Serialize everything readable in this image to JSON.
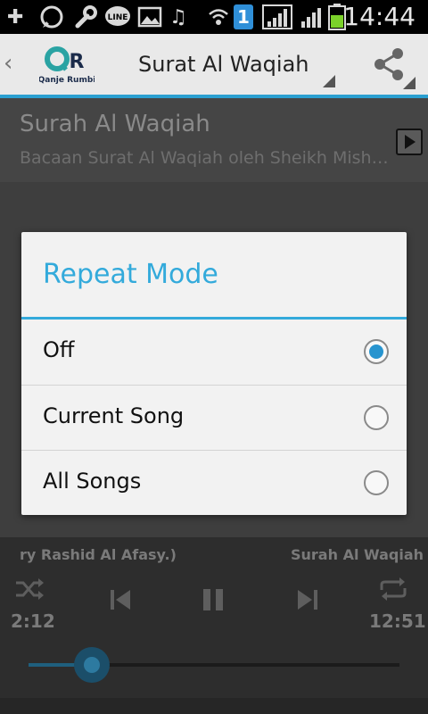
{
  "status_bar": {
    "time": "14:44",
    "notification_badge": "1",
    "icons": [
      "add-icon",
      "whatsapp-icon",
      "wrench-icon",
      "line-icon",
      "image-icon",
      "music-note-icon",
      "wifi-icon",
      "notification-badge-icon",
      "signal-icon",
      "signal-icon",
      "battery-icon"
    ]
  },
  "app_bar": {
    "title": "Surat Al Waqiah",
    "logo_text": "Qanje Rumbi"
  },
  "track_header": {
    "title": "Surah Al Waqiah",
    "subtitle": "Bacaan Surat Al Waqiah oleh Sheikh Mish…"
  },
  "dialog": {
    "title": "Repeat Mode",
    "options": [
      {
        "label": "Off",
        "selected": true
      },
      {
        "label": "Current Song",
        "selected": false
      },
      {
        "label": "All Songs",
        "selected": false
      }
    ]
  },
  "player": {
    "marquee_left": "ry Rashid Al Afasy.)",
    "marquee_right": "Surah Al Waqiah (",
    "elapsed": "2:12",
    "duration": "12:51",
    "progress": 0.17
  },
  "colors": {
    "accent": "#33aadb",
    "radio_selected": "#2794cf"
  }
}
